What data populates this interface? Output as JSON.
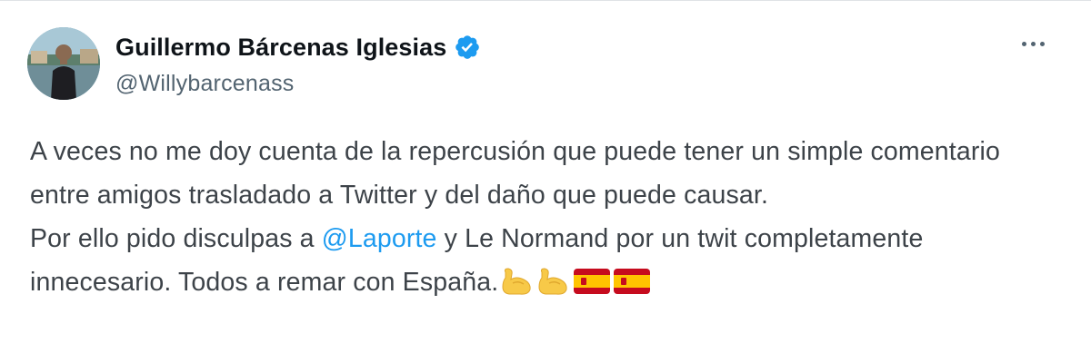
{
  "user": {
    "display_name": "Guillermo Bárcenas Iglesias",
    "handle": "@Willybarcenass",
    "verified": true,
    "avatar_icon": "profile-photo",
    "verified_color": "#1d9bf0"
  },
  "menu": {
    "more_icon": "more-options-icon"
  },
  "tweet": {
    "paragraph1": "A veces no me doy cuenta de la repercusión que puede tener un simple comentario entre amigos trasladado a Twitter y del daño que puede causar.",
    "p2_before": "Por ello pido disculpas a ",
    "mention": "@Laporte",
    "p2_after": " y Le Normand por un twit completamente innecesario. Todos a remar con España.",
    "emojis": [
      "flexed-biceps-icon",
      "flexed-biceps-icon",
      "spain-flag-icon",
      "spain-flag-icon"
    ],
    "mention_color": "#1d9bf0"
  }
}
